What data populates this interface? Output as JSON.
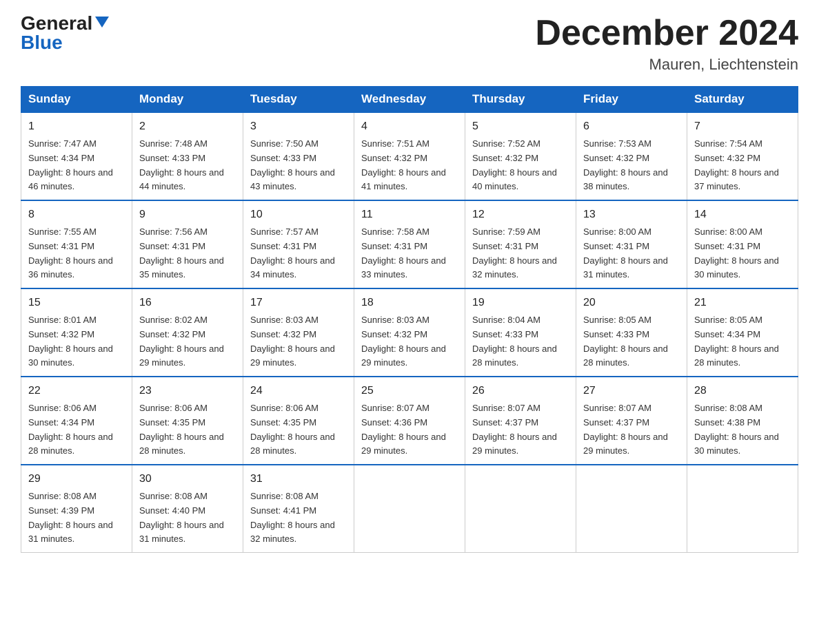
{
  "logo": {
    "general": "General",
    "blue": "Blue"
  },
  "header": {
    "title": "December 2024",
    "subtitle": "Mauren, Liechtenstein"
  },
  "weekdays": [
    "Sunday",
    "Monday",
    "Tuesday",
    "Wednesday",
    "Thursday",
    "Friday",
    "Saturday"
  ],
  "weeks": [
    [
      {
        "day": "1",
        "sunrise": "7:47 AM",
        "sunset": "4:34 PM",
        "daylight": "8 hours and 46 minutes."
      },
      {
        "day": "2",
        "sunrise": "7:48 AM",
        "sunset": "4:33 PM",
        "daylight": "8 hours and 44 minutes."
      },
      {
        "day": "3",
        "sunrise": "7:50 AM",
        "sunset": "4:33 PM",
        "daylight": "8 hours and 43 minutes."
      },
      {
        "day": "4",
        "sunrise": "7:51 AM",
        "sunset": "4:32 PM",
        "daylight": "8 hours and 41 minutes."
      },
      {
        "day": "5",
        "sunrise": "7:52 AM",
        "sunset": "4:32 PM",
        "daylight": "8 hours and 40 minutes."
      },
      {
        "day": "6",
        "sunrise": "7:53 AM",
        "sunset": "4:32 PM",
        "daylight": "8 hours and 38 minutes."
      },
      {
        "day": "7",
        "sunrise": "7:54 AM",
        "sunset": "4:32 PM",
        "daylight": "8 hours and 37 minutes."
      }
    ],
    [
      {
        "day": "8",
        "sunrise": "7:55 AM",
        "sunset": "4:31 PM",
        "daylight": "8 hours and 36 minutes."
      },
      {
        "day": "9",
        "sunrise": "7:56 AM",
        "sunset": "4:31 PM",
        "daylight": "8 hours and 35 minutes."
      },
      {
        "day": "10",
        "sunrise": "7:57 AM",
        "sunset": "4:31 PM",
        "daylight": "8 hours and 34 minutes."
      },
      {
        "day": "11",
        "sunrise": "7:58 AM",
        "sunset": "4:31 PM",
        "daylight": "8 hours and 33 minutes."
      },
      {
        "day": "12",
        "sunrise": "7:59 AM",
        "sunset": "4:31 PM",
        "daylight": "8 hours and 32 minutes."
      },
      {
        "day": "13",
        "sunrise": "8:00 AM",
        "sunset": "4:31 PM",
        "daylight": "8 hours and 31 minutes."
      },
      {
        "day": "14",
        "sunrise": "8:00 AM",
        "sunset": "4:31 PM",
        "daylight": "8 hours and 30 minutes."
      }
    ],
    [
      {
        "day": "15",
        "sunrise": "8:01 AM",
        "sunset": "4:32 PM",
        "daylight": "8 hours and 30 minutes."
      },
      {
        "day": "16",
        "sunrise": "8:02 AM",
        "sunset": "4:32 PM",
        "daylight": "8 hours and 29 minutes."
      },
      {
        "day": "17",
        "sunrise": "8:03 AM",
        "sunset": "4:32 PM",
        "daylight": "8 hours and 29 minutes."
      },
      {
        "day": "18",
        "sunrise": "8:03 AM",
        "sunset": "4:32 PM",
        "daylight": "8 hours and 29 minutes."
      },
      {
        "day": "19",
        "sunrise": "8:04 AM",
        "sunset": "4:33 PM",
        "daylight": "8 hours and 28 minutes."
      },
      {
        "day": "20",
        "sunrise": "8:05 AM",
        "sunset": "4:33 PM",
        "daylight": "8 hours and 28 minutes."
      },
      {
        "day": "21",
        "sunrise": "8:05 AM",
        "sunset": "4:34 PM",
        "daylight": "8 hours and 28 minutes."
      }
    ],
    [
      {
        "day": "22",
        "sunrise": "8:06 AM",
        "sunset": "4:34 PM",
        "daylight": "8 hours and 28 minutes."
      },
      {
        "day": "23",
        "sunrise": "8:06 AM",
        "sunset": "4:35 PM",
        "daylight": "8 hours and 28 minutes."
      },
      {
        "day": "24",
        "sunrise": "8:06 AM",
        "sunset": "4:35 PM",
        "daylight": "8 hours and 28 minutes."
      },
      {
        "day": "25",
        "sunrise": "8:07 AM",
        "sunset": "4:36 PM",
        "daylight": "8 hours and 29 minutes."
      },
      {
        "day": "26",
        "sunrise": "8:07 AM",
        "sunset": "4:37 PM",
        "daylight": "8 hours and 29 minutes."
      },
      {
        "day": "27",
        "sunrise": "8:07 AM",
        "sunset": "4:37 PM",
        "daylight": "8 hours and 29 minutes."
      },
      {
        "day": "28",
        "sunrise": "8:08 AM",
        "sunset": "4:38 PM",
        "daylight": "8 hours and 30 minutes."
      }
    ],
    [
      {
        "day": "29",
        "sunrise": "8:08 AM",
        "sunset": "4:39 PM",
        "daylight": "8 hours and 31 minutes."
      },
      {
        "day": "30",
        "sunrise": "8:08 AM",
        "sunset": "4:40 PM",
        "daylight": "8 hours and 31 minutes."
      },
      {
        "day": "31",
        "sunrise": "8:08 AM",
        "sunset": "4:41 PM",
        "daylight": "8 hours and 32 minutes."
      },
      null,
      null,
      null,
      null
    ]
  ],
  "labels": {
    "sunrise_prefix": "Sunrise: ",
    "sunset_prefix": "Sunset: ",
    "daylight_prefix": "Daylight: "
  }
}
